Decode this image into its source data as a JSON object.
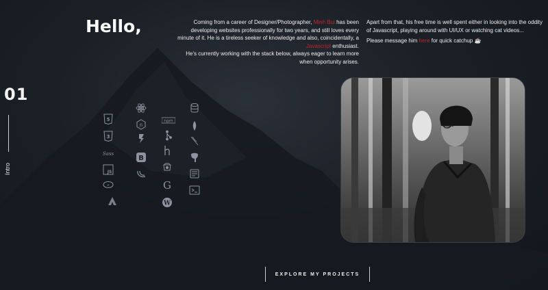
{
  "section": {
    "number": "01",
    "label": "Intro"
  },
  "greeting": "Hello,",
  "bio": {
    "p1_a": "Coming from a career of Designer/Photographer,",
    "name": "Minh Bui",
    "p1_b": "has been developing websites professionally for two years, and still loves every minute of it. He is a tireless seeker of knowledge and also, coincidentally, a",
    "javascript": "Javascript",
    "p1_c": "enthusiast.",
    "p2": "He's currently working with the stack below, always eager to learn more when opportunity arises.",
    "p3": "Apart from that, his free time is well spent either in looking into the oddity of Javascript, playing around with UI/UX or watching cat videos...",
    "p4_a": "Please message him",
    "contact_link": "here",
    "p4_b": "for quick catchup"
  },
  "tech_icons": [
    "html5-icon",
    "react-icon",
    "database-icon",
    "css3-icon",
    "nodejs-icon",
    "npm-icon",
    "mongodb-icon",
    "sass-icon",
    "jest-icon",
    "git-icon",
    "gulp-icon",
    "javascript-icon",
    "bootstrap-icon",
    "heroku-icon",
    "postgresql-icon",
    "ember-icon",
    "jquery-icon",
    "mocha-icon",
    "graphql-icon",
    "aws-icon",
    "google-icon",
    "terminal-icon",
    "wordpress-icon"
  ],
  "npm_text": "npm",
  "cta": {
    "explore_label": "EXPLORE MY PROJECTS"
  },
  "colors": {
    "accent": "#c0262c",
    "icon": "#8d93a0",
    "background": "#1b2027"
  }
}
